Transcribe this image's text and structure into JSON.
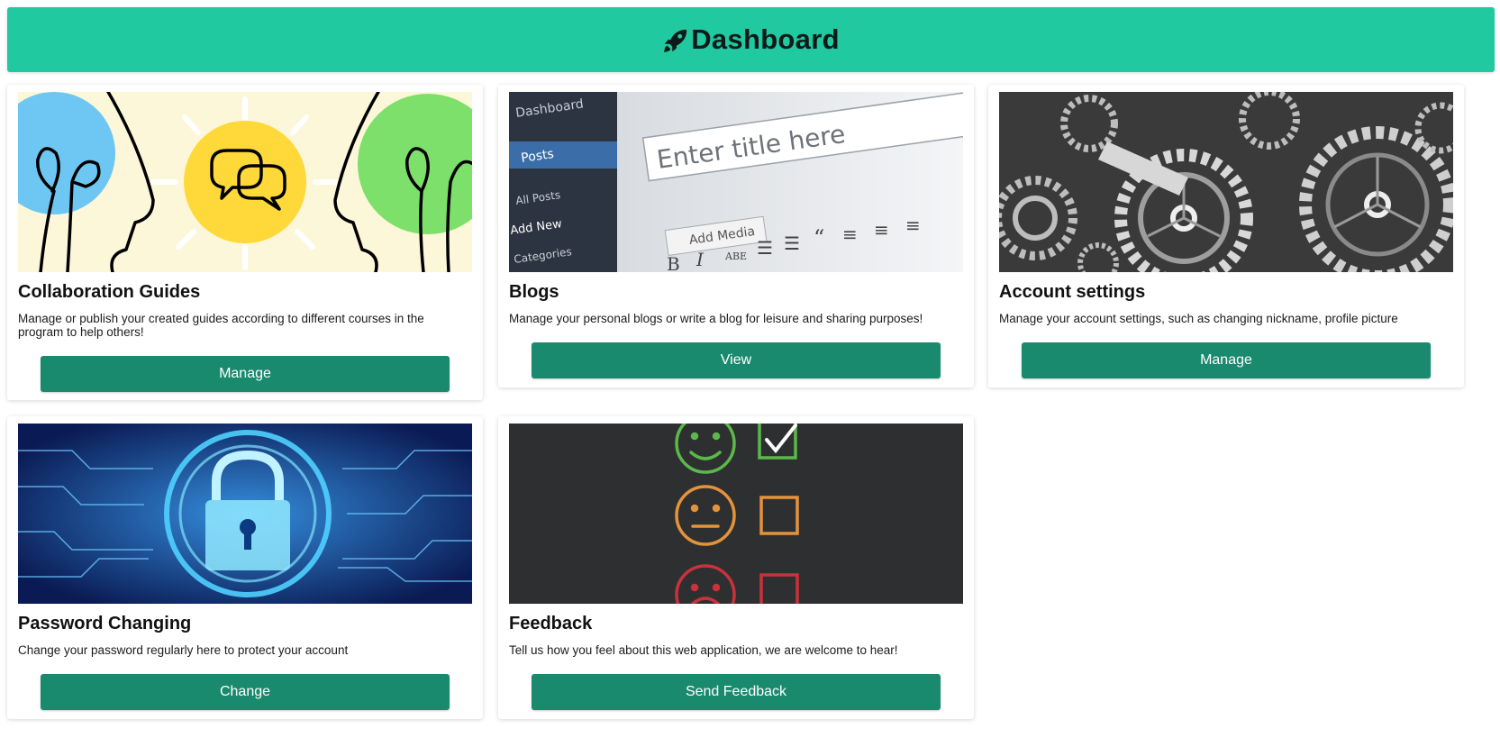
{
  "header": {
    "title": "Dashboard",
    "icon": "rocket-icon",
    "color": "#20c9a0"
  },
  "accent": {
    "button": "#1a8a6e"
  },
  "cards": [
    {
      "title": "Collaboration Guides",
      "description": "Manage or publish your created guides according to different courses in the program to help others!",
      "button": "Manage",
      "image": "collaboration-illustration"
    },
    {
      "title": "Blogs",
      "description": "Manage your personal blogs or write a blog for leisure and sharing purposes!",
      "button": "View",
      "image": "blog-editor-photo",
      "image_text": {
        "sidebar_title": "Dashboard",
        "posts": "Posts",
        "all_posts": "All Posts",
        "add_new": "Add New",
        "categories": "Categories",
        "editor_placeholder": "Enter title here",
        "add_media": "Add Media"
      }
    },
    {
      "title": "Account settings",
      "description": "Manage your account settings, such as changing nickname, profile picture",
      "button": "Manage",
      "image": "gears-photo"
    },
    {
      "title": "Password Changing",
      "description": "Change your password regularly here to protect your account",
      "button": "Change",
      "image": "padlock-circuit-photo"
    },
    {
      "title": "Feedback",
      "description": "Tell us how you feel about this web application, we are welcome to hear!",
      "button": "Send Feedback",
      "image": "feedback-faces-chalkboard"
    }
  ]
}
